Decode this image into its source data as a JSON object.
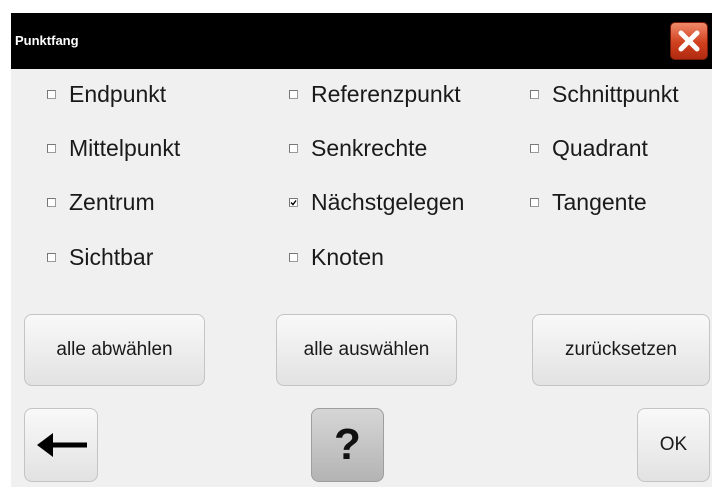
{
  "dialog": {
    "title": "Punktfang"
  },
  "options": [
    {
      "label": "Endpunkt",
      "checked": false
    },
    {
      "label": "Referenzpunkt",
      "checked": false
    },
    {
      "label": "Schnittpunkt",
      "checked": false
    },
    {
      "label": "Mittelpunkt",
      "checked": false
    },
    {
      "label": "Senkrechte",
      "checked": false
    },
    {
      "label": "Quadrant",
      "checked": false
    },
    {
      "label": "Zentrum",
      "checked": false
    },
    {
      "label": "Nächstgelegen",
      "checked": true
    },
    {
      "label": "Tangente",
      "checked": false
    },
    {
      "label": "Sichtbar",
      "checked": false
    },
    {
      "label": "Knoten",
      "checked": false
    }
  ],
  "actions": {
    "deselect_all": "alle abwählen",
    "select_all": "alle auswählen",
    "reset": "zurücksetzen",
    "help": "?",
    "ok": "OK"
  },
  "icons": {
    "close": "close-icon",
    "back": "arrow-left-icon"
  },
  "colors": {
    "titlebar": "#000000",
    "close_button": "#d0401e",
    "panel": "#f0f0f0"
  }
}
